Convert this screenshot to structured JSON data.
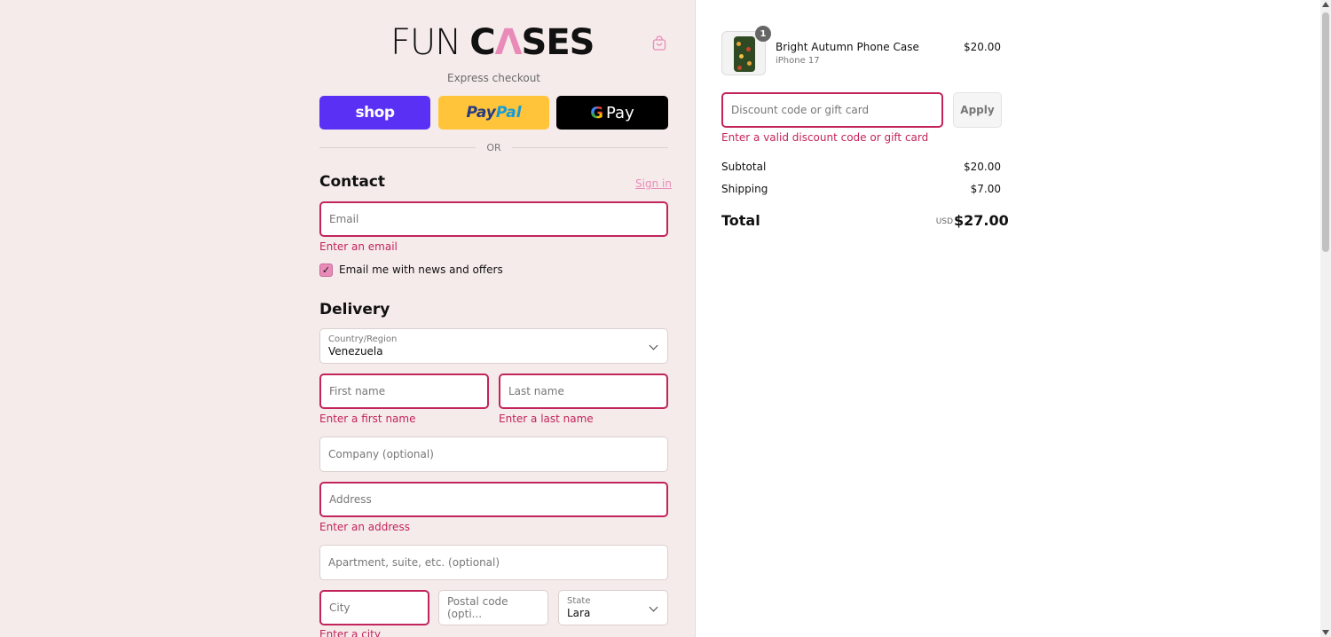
{
  "brand": {
    "logo_part1": "FUN",
    "logo_part2_c": "C",
    "logo_part2_a": "Λ",
    "logo_part2_rest": "SES"
  },
  "express": {
    "label": "Express checkout",
    "shop_label": "shop",
    "paypal_label_1": "Pay",
    "paypal_label_2": "Pal",
    "gpay_g": "G",
    "gpay_label": "Pay",
    "or_label": "OR"
  },
  "contact": {
    "title": "Contact",
    "signin_label": "Sign in",
    "email_placeholder": "Email",
    "email_error": "Enter an email",
    "newsletter_label": "Email me with news and offers",
    "newsletter_checked": true
  },
  "delivery": {
    "title": "Delivery",
    "country_label": "Country/Region",
    "country_value": "Venezuela",
    "first_name_placeholder": "First name",
    "first_name_error": "Enter a first name",
    "last_name_placeholder": "Last name",
    "last_name_error": "Enter a last name",
    "company_placeholder": "Company (optional)",
    "address_placeholder": "Address",
    "address_error": "Enter an address",
    "apartment_placeholder": "Apartment, suite, etc. (optional)",
    "city_placeholder": "City",
    "city_error": "Enter a city",
    "postal_placeholder": "Postal code (opti...",
    "state_label": "State",
    "state_value": "Lara"
  },
  "summary": {
    "product": {
      "name": "Bright Autumn Phone Case",
      "variant": "iPhone 17",
      "price": "$20.00",
      "quantity": "1"
    },
    "discount_placeholder": "Discount code or gift card",
    "discount_error": "Enter a valid discount code or gift card",
    "apply_label": "Apply",
    "subtotal_label": "Subtotal",
    "subtotal_value": "$20.00",
    "shipping_label": "Shipping",
    "shipping_value": "$7.00",
    "total_label": "Total",
    "total_currency": "USD",
    "total_value": "$27.00"
  },
  "colors": {
    "left_bg": "#f6ebeb",
    "accent_pink": "#e98bb8",
    "error": "#c2245b",
    "shop_purple": "#5a31f4",
    "paypal_yellow": "#ffc439"
  }
}
